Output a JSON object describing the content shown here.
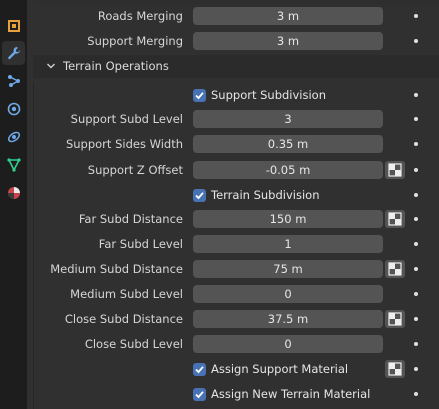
{
  "toolbar": {
    "icons": [
      "object-icon",
      "wrench-icon",
      "particles-icon",
      "physics-icon",
      "constraints-icon",
      "data-icon",
      "material-icon"
    ]
  },
  "props": {
    "roads_merging": {
      "label": "Roads Merging",
      "value": "3 m"
    },
    "support_merging": {
      "label": "Support Merging",
      "value": "3 m"
    },
    "section_title": "Terrain Operations",
    "support_subdivision": {
      "label": "Support Subdivision",
      "checked": true
    },
    "support_subd_level": {
      "label": "Support Subd Level",
      "value": "3"
    },
    "support_sides_width": {
      "label": "Support Sides Width",
      "value": "0.35 m"
    },
    "support_z_offset": {
      "label": "Support Z Offset",
      "value": "-0.05 m"
    },
    "terrain_subdivision": {
      "label": "Terrain Subdivision",
      "checked": true
    },
    "far_subd_distance": {
      "label": "Far Subd Distance",
      "value": "150 m"
    },
    "far_subd_level": {
      "label": "Far Subd Level",
      "value": "1"
    },
    "medium_subd_distance": {
      "label": "Medium Subd Distance",
      "value": "75 m"
    },
    "medium_subd_level": {
      "label": "Medium Subd Level",
      "value": "0"
    },
    "close_subd_distance": {
      "label": "Close Subd Distance",
      "value": "37.5 m"
    },
    "close_subd_level": {
      "label": "Close Subd Level",
      "value": "0"
    },
    "assign_support_material": {
      "label": "Assign Support Material",
      "checked": true
    },
    "assign_new_terrain_material": {
      "label": "Assign New Terrain Material",
      "checked": true
    }
  },
  "colors": {
    "accent": "#4772b3",
    "field": "#545454",
    "panel": "#303030",
    "sidebar": "#1d1d1d"
  }
}
